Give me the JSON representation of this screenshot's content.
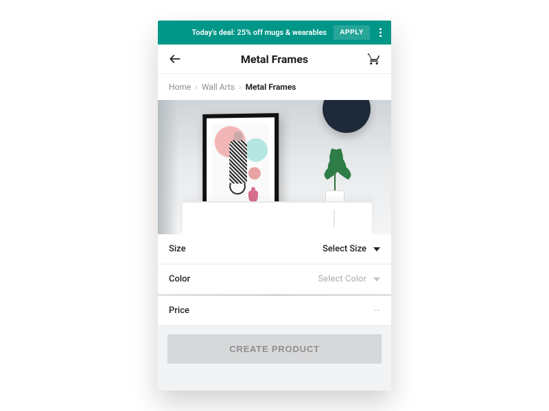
{
  "colors": {
    "brand": "#009688"
  },
  "promo": {
    "text": "Today's deal: 25% off mugs & wearables",
    "apply_label": "APPLY",
    "menu_icon": "kebab-icon"
  },
  "appbar": {
    "title": "Metal Frames",
    "back_icon": "arrow-back-icon",
    "cart_icon": "shopping-cart-icon"
  },
  "breadcrumb": {
    "items": [
      "Home",
      "Wall Arts",
      "Metal Frames"
    ],
    "separator": "›"
  },
  "options": {
    "size": {
      "label": "Size",
      "value": "Select Size",
      "enabled": true
    },
    "color": {
      "label": "Color",
      "value": "Select Color",
      "enabled": false
    },
    "price": {
      "label": "Price",
      "value": "--"
    }
  },
  "cta": {
    "label": "CREATE PRODUCT",
    "enabled": false
  }
}
